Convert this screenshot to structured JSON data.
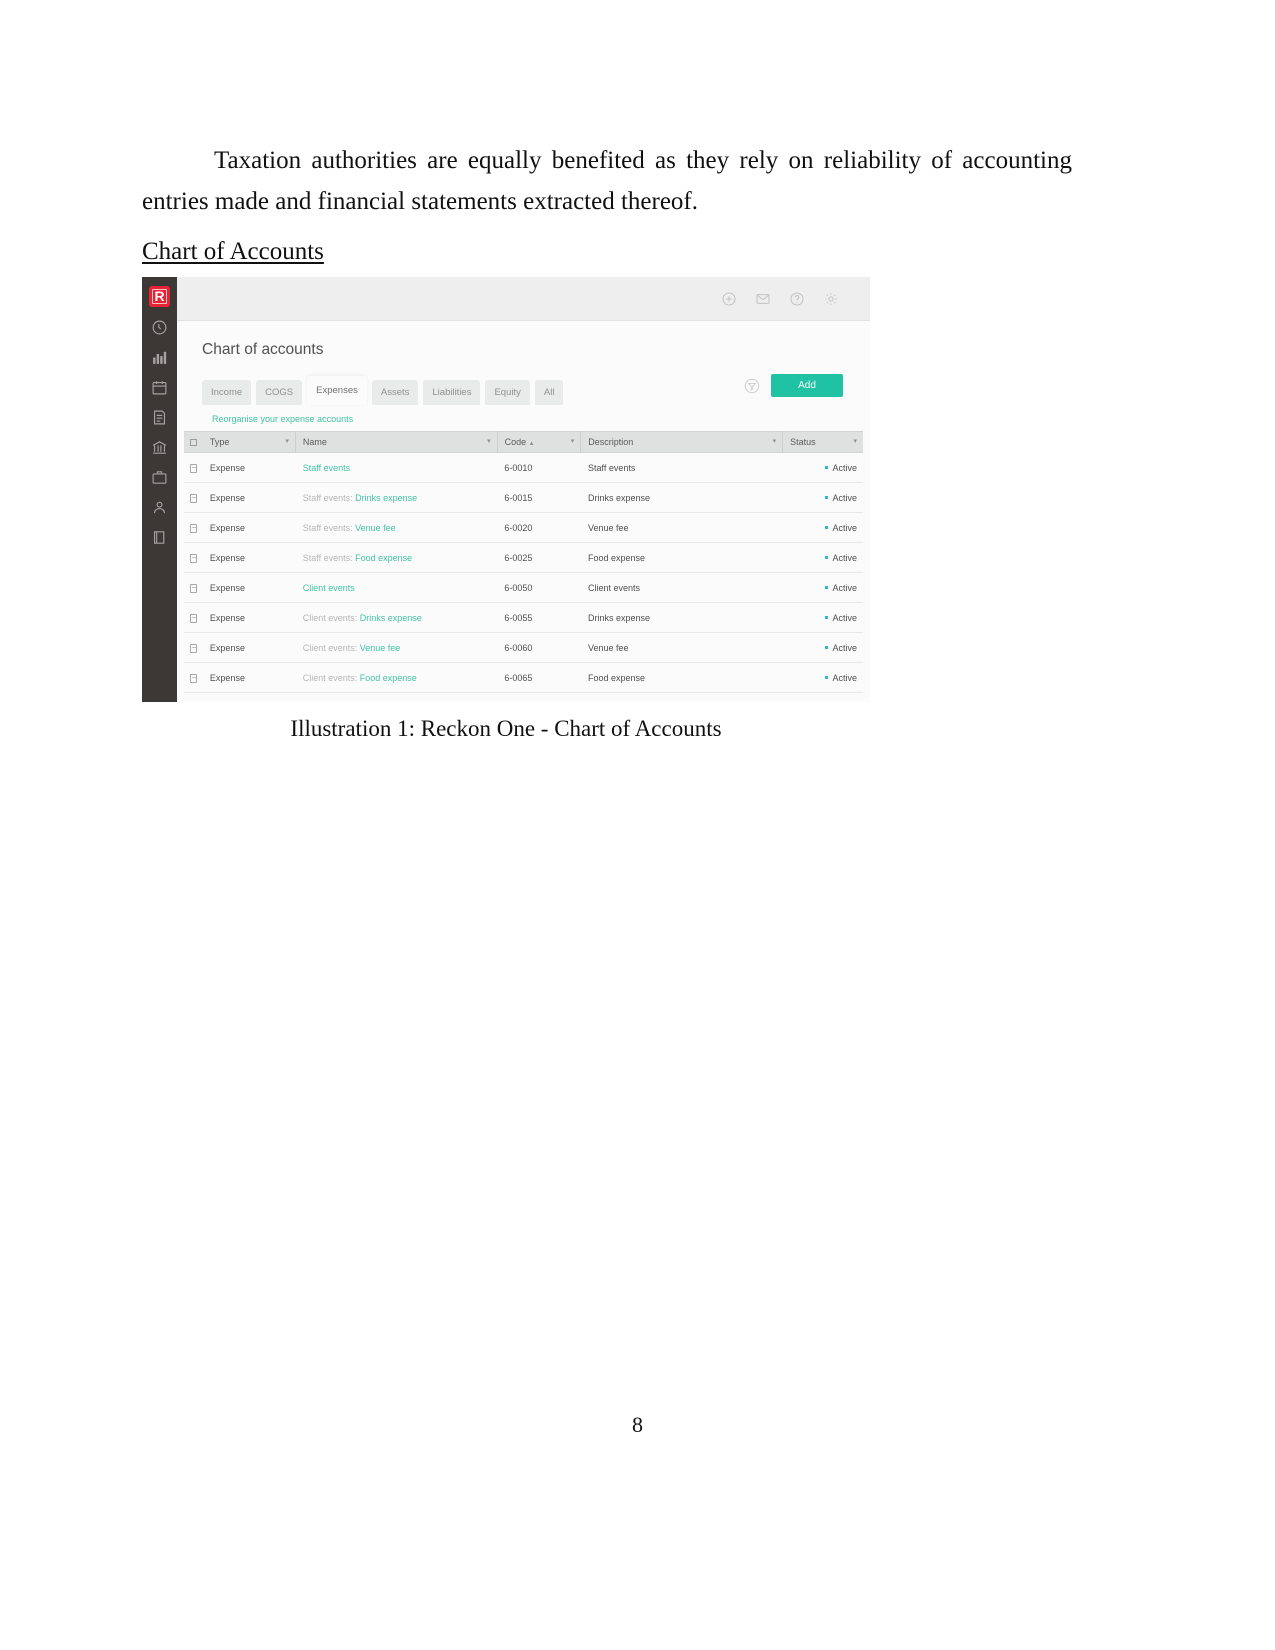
{
  "document": {
    "paragraph": "Taxation authorities are equally benefited as they rely on reliability of accounting entries made and financial statements extracted thereof.",
    "section_heading": "Chart of Accounts",
    "caption": "Illustration 1: Reckon One - Chart of Accounts",
    "page_number": "8"
  },
  "screenshot": {
    "rail": {
      "logo_letter": "R",
      "items": [
        {
          "icon": "clock-history-icon"
        },
        {
          "icon": "bar-chart-icon"
        },
        {
          "icon": "calendar-icon"
        },
        {
          "icon": "invoice-icon"
        },
        {
          "icon": "bank-icon"
        },
        {
          "icon": "briefcase-icon"
        },
        {
          "icon": "people-icon"
        },
        {
          "icon": "book-icon"
        }
      ]
    },
    "topbar": {
      "icons": [
        {
          "icon": "add-circle-icon"
        },
        {
          "icon": "mail-icon"
        },
        {
          "icon": "help-circle-icon"
        },
        {
          "icon": "gear-icon"
        }
      ]
    },
    "page_title": "Chart of accounts",
    "tabs": [
      {
        "label": "Income",
        "active": false
      },
      {
        "label": "COGS",
        "active": false
      },
      {
        "label": "Expenses",
        "active": true
      },
      {
        "label": "Assets",
        "active": false
      },
      {
        "label": "Liabilities",
        "active": false
      },
      {
        "label": "Equity",
        "active": false
      },
      {
        "label": "All",
        "active": false
      }
    ],
    "toolbar": {
      "filter_icon": "filter-circle-icon",
      "add_label": "Add",
      "add_color": "#17c3a2"
    },
    "reorganise_link": "Reorganise your expense accounts",
    "table": {
      "columns": [
        {
          "key": "select",
          "label": ""
        },
        {
          "key": "type",
          "label": "Type",
          "sort": ""
        },
        {
          "key": "name",
          "label": "Name",
          "sort": ""
        },
        {
          "key": "code",
          "label": "Code",
          "sort": "▲"
        },
        {
          "key": "description",
          "label": "Description",
          "sort": ""
        },
        {
          "key": "status",
          "label": "Status",
          "sort": ""
        }
      ],
      "rows": [
        {
          "type": "Expense",
          "name_parent": "",
          "name_link": "Staff events",
          "code": "6-0010",
          "description": "Staff events",
          "status": "Active"
        },
        {
          "type": "Expense",
          "name_parent": "Staff events:",
          "name_link": "Drinks expense",
          "code": "6-0015",
          "description": "Drinks expense",
          "status": "Active"
        },
        {
          "type": "Expense",
          "name_parent": "Staff events:",
          "name_link": "Venue fee",
          "code": "6-0020",
          "description": "Venue fee",
          "status": "Active"
        },
        {
          "type": "Expense",
          "name_parent": "Staff events:",
          "name_link": "Food expense",
          "code": "6-0025",
          "description": "Food expense",
          "status": "Active"
        },
        {
          "type": "Expense",
          "name_parent": "",
          "name_link": "Client events",
          "code": "6-0050",
          "description": "Client events",
          "status": "Active"
        },
        {
          "type": "Expense",
          "name_parent": "Client events:",
          "name_link": "Drinks expense",
          "code": "6-0055",
          "description": "Drinks expense",
          "status": "Active"
        },
        {
          "type": "Expense",
          "name_parent": "Client events:",
          "name_link": "Venue fee",
          "code": "6-0060",
          "description": "Venue fee",
          "status": "Active"
        },
        {
          "type": "Expense",
          "name_parent": "Client events:",
          "name_link": "Food expense",
          "code": "6-0065",
          "description": "Food expense",
          "status": "Active"
        }
      ]
    },
    "colors": {
      "brand_red": "#ec1b2e",
      "accent_green": "#17c3a2",
      "link_green": "#3cc3a4",
      "status_dot": "#29b6d8",
      "rail_dark": "#35312f"
    }
  }
}
